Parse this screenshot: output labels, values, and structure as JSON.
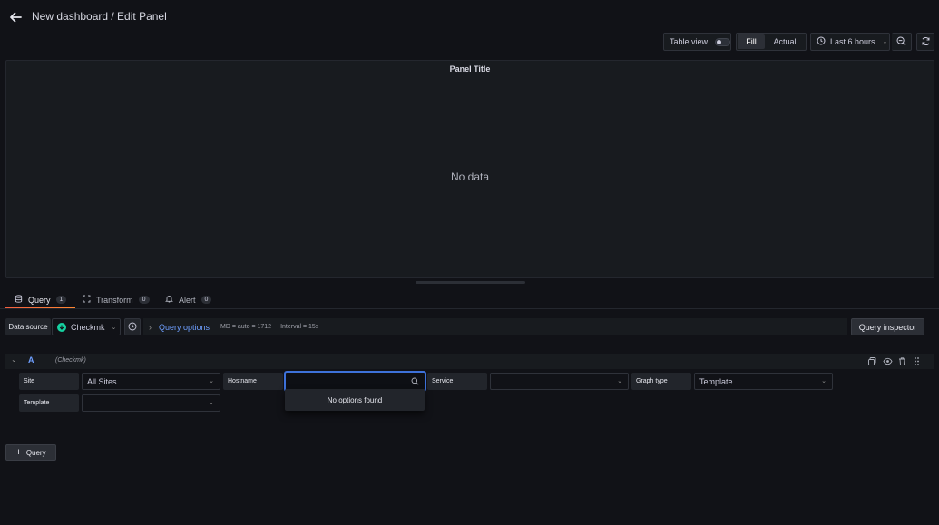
{
  "header": {
    "title": "New dashboard / Edit Panel"
  },
  "toolbar": {
    "table_view_label": "Table view",
    "table_view_on": false,
    "fill_label": "Fill",
    "actual_label": "Actual",
    "time_range_label": "Last 6 hours"
  },
  "panel": {
    "title": "Panel Title",
    "empty_text": "No data"
  },
  "tabs": [
    {
      "label": "Query",
      "count": "1",
      "active": true
    },
    {
      "label": "Transform",
      "count": "0",
      "active": false
    },
    {
      "label": "Alert",
      "count": "0",
      "active": false
    }
  ],
  "datasource": {
    "label": "Data source",
    "selected": "Checkmk",
    "query_options_label": "Query options",
    "md_text": "MD = auto = 1712",
    "interval_text": "Interval = 15s",
    "query_inspector_label": "Query inspector"
  },
  "query_row": {
    "ref_id": "A",
    "datasource_name": "(Checkmk)",
    "fields": {
      "site_label": "Site",
      "site_value": "All Sites",
      "hostname_label": "Hostname",
      "hostname_value": "",
      "service_label": "Service",
      "service_value": "",
      "graph_type_label": "Graph type",
      "graph_type_value": "Template",
      "template_label": "Template",
      "template_value": ""
    },
    "dropdown_message": "No options found"
  },
  "add_query_label": "Query",
  "colors": {
    "accent_blue": "#6e9fff",
    "tab_underline": "#f55f3e",
    "checkmk_green": "#15d1a0",
    "focus_border": "#3d71d9"
  }
}
